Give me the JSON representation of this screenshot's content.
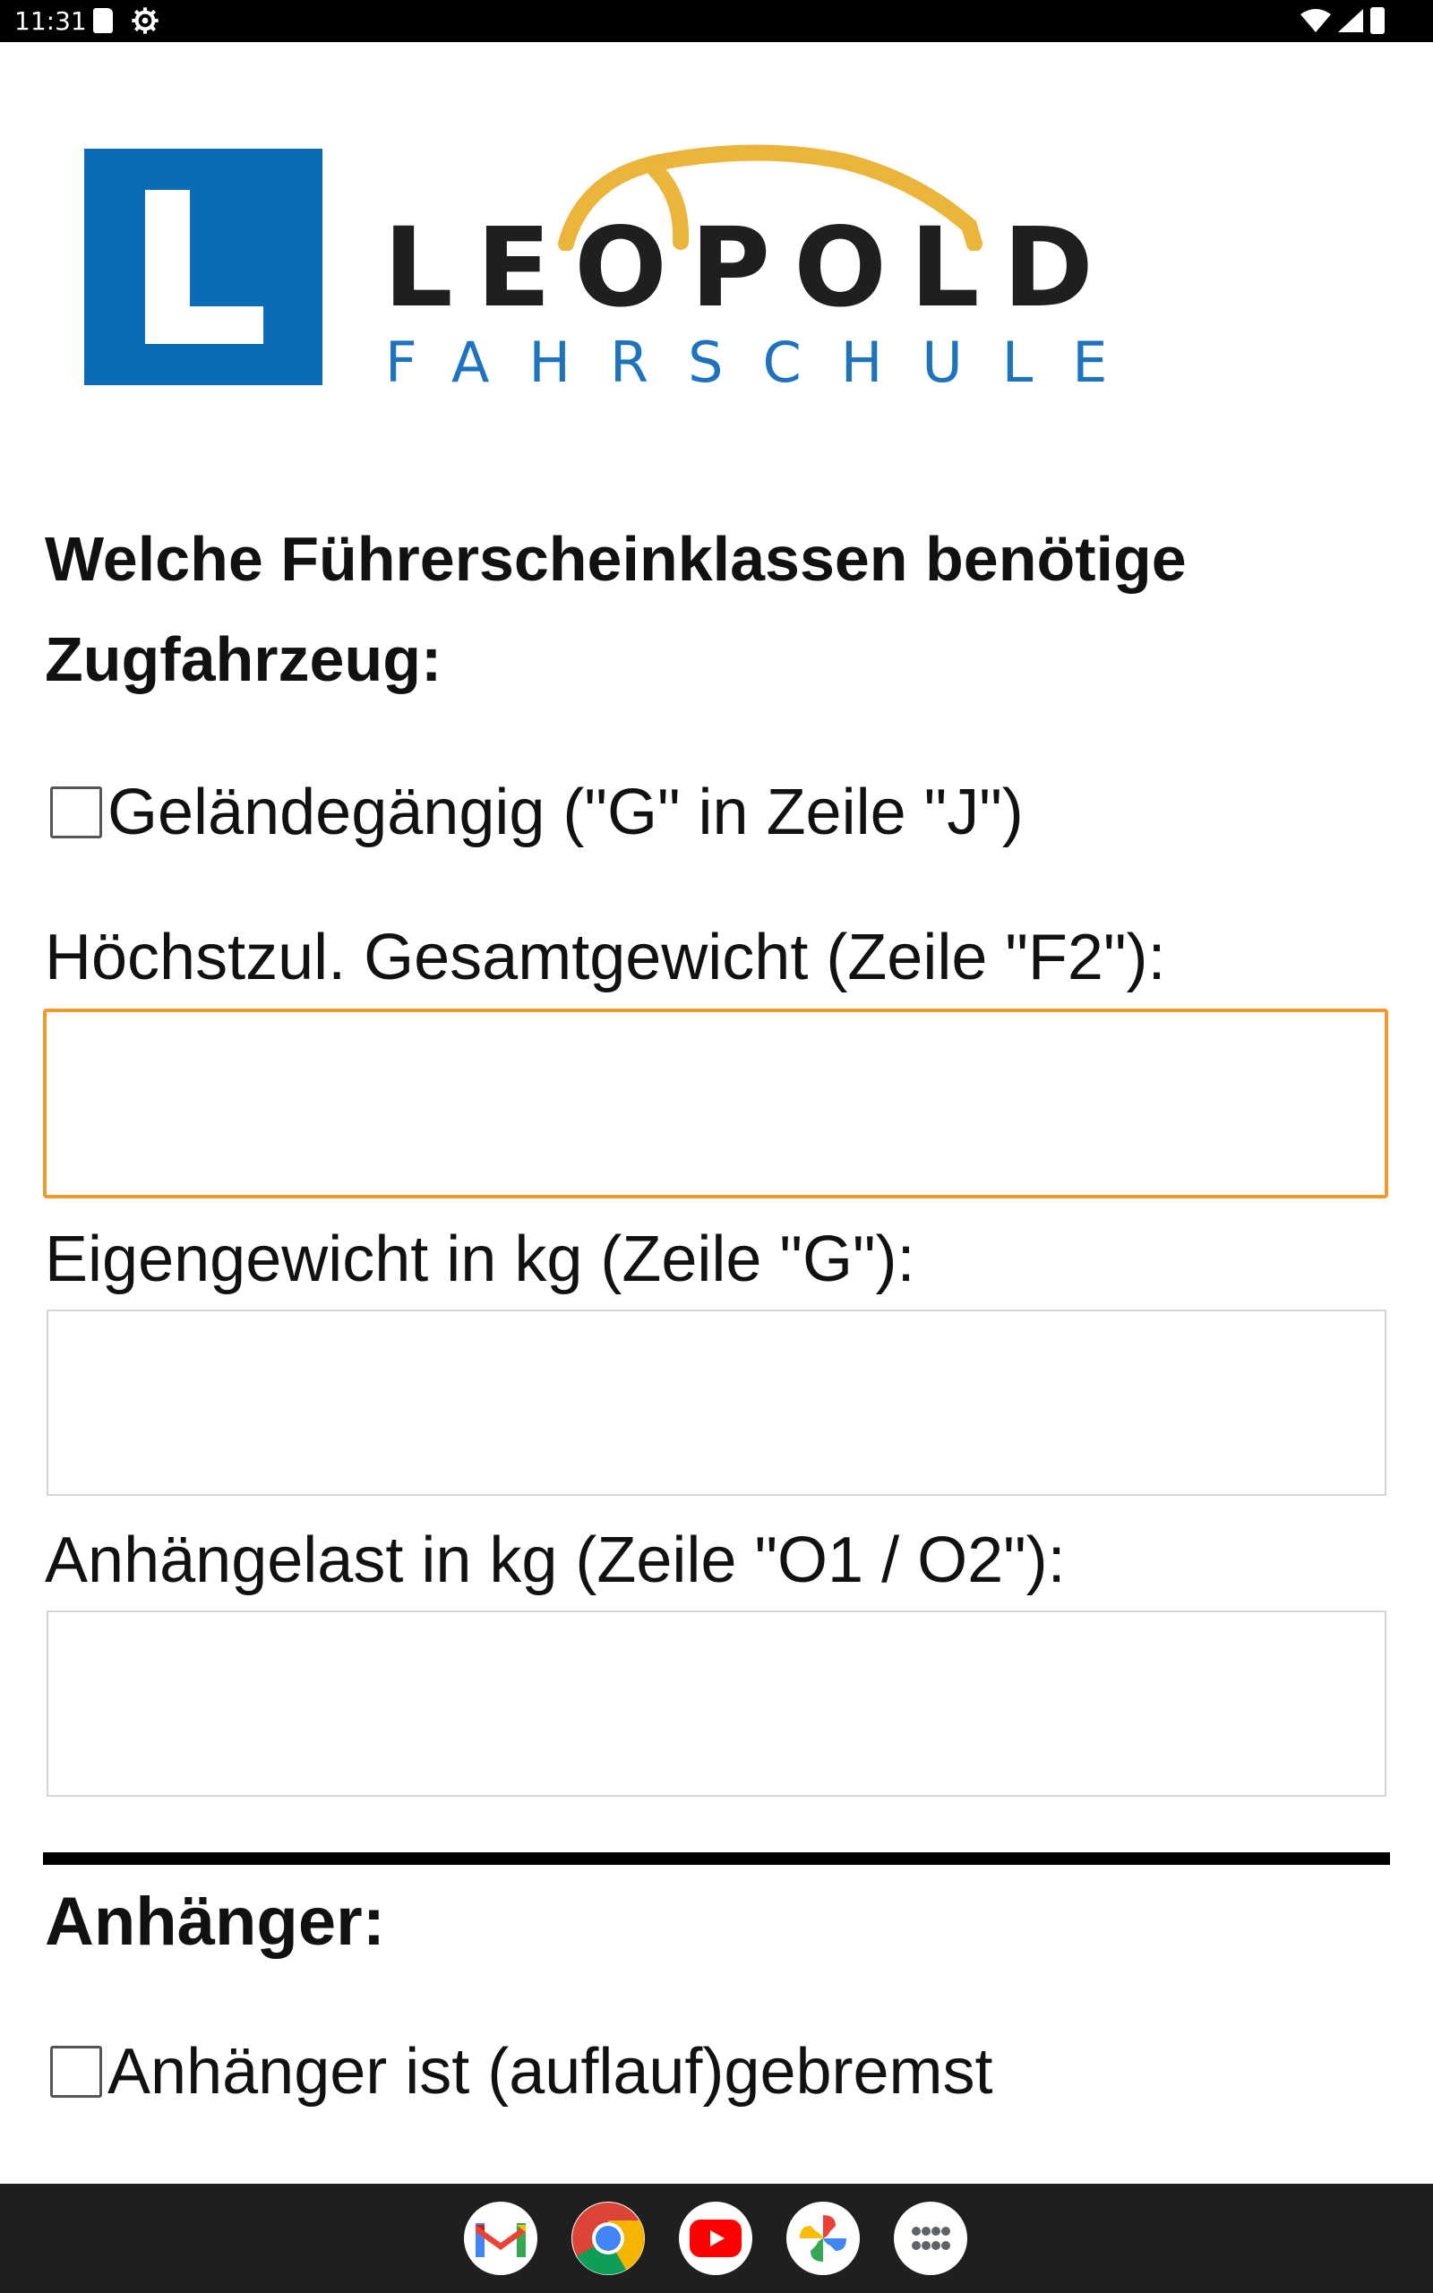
{
  "status_bar": {
    "time": "11:31",
    "icons": [
      "sd-card-icon",
      "settings-gear-icon",
      "wifi-icon",
      "cell-signal-icon",
      "battery-icon"
    ]
  },
  "logo": {
    "badge_letter": "L",
    "wordmark": "LEOPOLD",
    "subtitle": "FAHRSCHULE",
    "colors": {
      "blue": "#0a6cb5",
      "gold": "#eab53a",
      "dark": "#1f1f1f"
    }
  },
  "form": {
    "question": "Welche Führerscheinklassen benötige Zugfahrzeug:",
    "offroad_checkbox": {
      "label": "Geländegängig (\"G\" in Zeile \"J\")",
      "checked": false
    },
    "fields": [
      {
        "label": "Höchstzul. Gesamtgewicht (Zeile \"F2\"):",
        "value": "",
        "placeholder": "",
        "focused": true
      },
      {
        "label": "Eigengewicht in kg (Zeile \"G\"):",
        "value": "",
        "placeholder": "",
        "focused": false
      },
      {
        "label": "Anhängelast in kg  (Zeile \"O1 / O2\"):",
        "value": "",
        "placeholder": "",
        "focused": false
      }
    ],
    "trailer_section": {
      "title": "Anhänger:",
      "braked_checkbox": {
        "label": "Anhänger ist (auflauf)gebremst",
        "checked": false
      }
    },
    "focus_color": "#ef9a2b"
  },
  "dock": {
    "apps": [
      "gmail-icon",
      "chrome-icon",
      "youtube-icon",
      "photos-icon",
      "app-drawer-icon"
    ]
  }
}
